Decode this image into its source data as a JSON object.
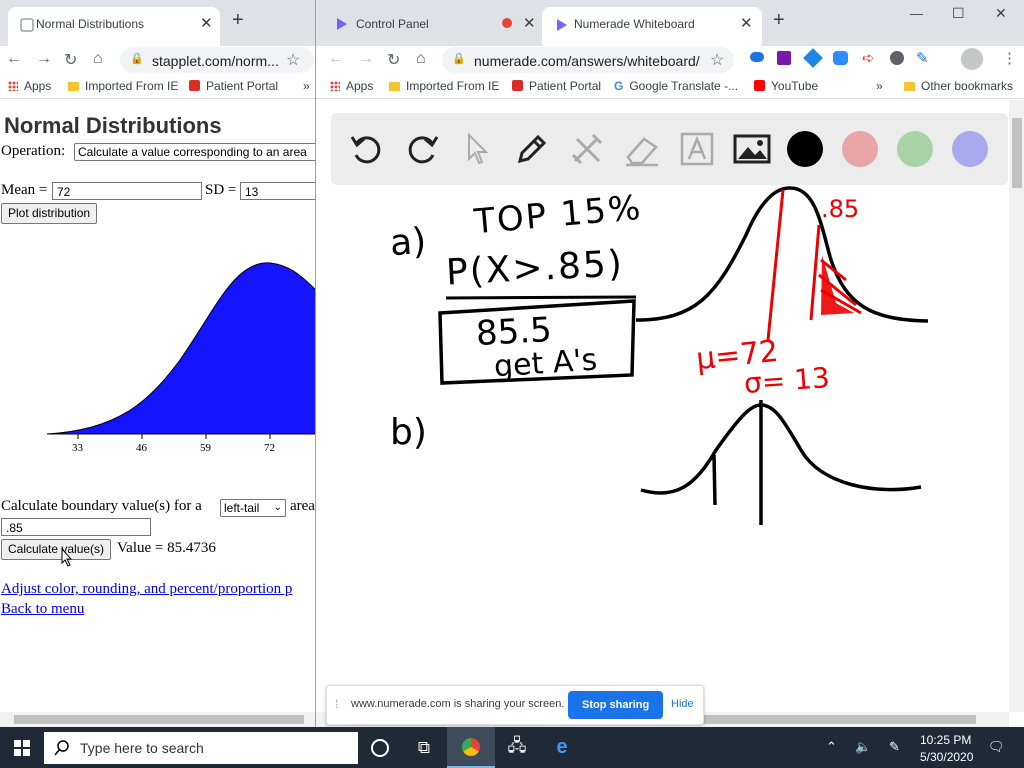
{
  "left_window": {
    "tab": {
      "title": "Normal Distributions",
      "close": "✕"
    },
    "new_tab": "+",
    "address": "stapplet.com/norm...",
    "bookmarks": [
      "Apps",
      "Imported From IE",
      "Patient Portal"
    ],
    "bookmarks_more": "»",
    "page": {
      "title": "Normal Distributions",
      "operation_label": "Operation:",
      "operation_value": "Calculate a value corresponding to an area",
      "mean_label": "Mean =",
      "mean_value": "72",
      "sd_label": "SD =",
      "sd_value": "13",
      "plot_button": "Plot distribution",
      "axis_ticks": [
        "33",
        "46",
        "59",
        "72"
      ],
      "boundary_prefix": "Calculate boundary value(s) for a",
      "tail_value": "left-tail",
      "boundary_suffix": "area",
      "area_value": ".85",
      "calc_button": "Calculate value(s)",
      "result_text": "Value = 85.4736",
      "adjust_link": "Adjust color, rounding, and percent/proportion p",
      "back_link": "Back to menu"
    },
    "curve_color": "#1414ff"
  },
  "right_window": {
    "tabs": [
      {
        "title": "Control Panel",
        "close": "✕"
      },
      {
        "title": "Numerade Whiteboard",
        "close": "✕"
      }
    ],
    "new_tab": "+",
    "window_controls": [
      "—",
      "☐",
      "✕"
    ],
    "address": "numerade.com/answers/whiteboard/",
    "bookmarks": [
      "Apps",
      "Imported From IE",
      "Patient Portal",
      "Google Translate -...",
      "YouTube"
    ],
    "bookmarks_more": "»",
    "other_bookmarks": "Other bookmarks",
    "colors": {
      "black": "#000000",
      "pink": "#e8a6a6",
      "green": "#a9d3a6",
      "blue": "#a9a9ee"
    },
    "whiteboard": {
      "a_label": "a)",
      "top_text": "TOP 15%",
      "prob_text": "P(X>.85)",
      "box_line1": "85.5",
      "box_line2": "get A's",
      "red_85": ".85",
      "mu_text": "μ=72",
      "sigma_text": "σ= 13",
      "b_label": "b)"
    },
    "share_bar": {
      "text": "www.numerade.com is sharing your screen.",
      "stop": "Stop sharing",
      "hide": "Hide"
    }
  },
  "taskbar": {
    "search_placeholder": "Type here to search",
    "time": "10:25 PM",
    "date": "5/30/2020"
  }
}
